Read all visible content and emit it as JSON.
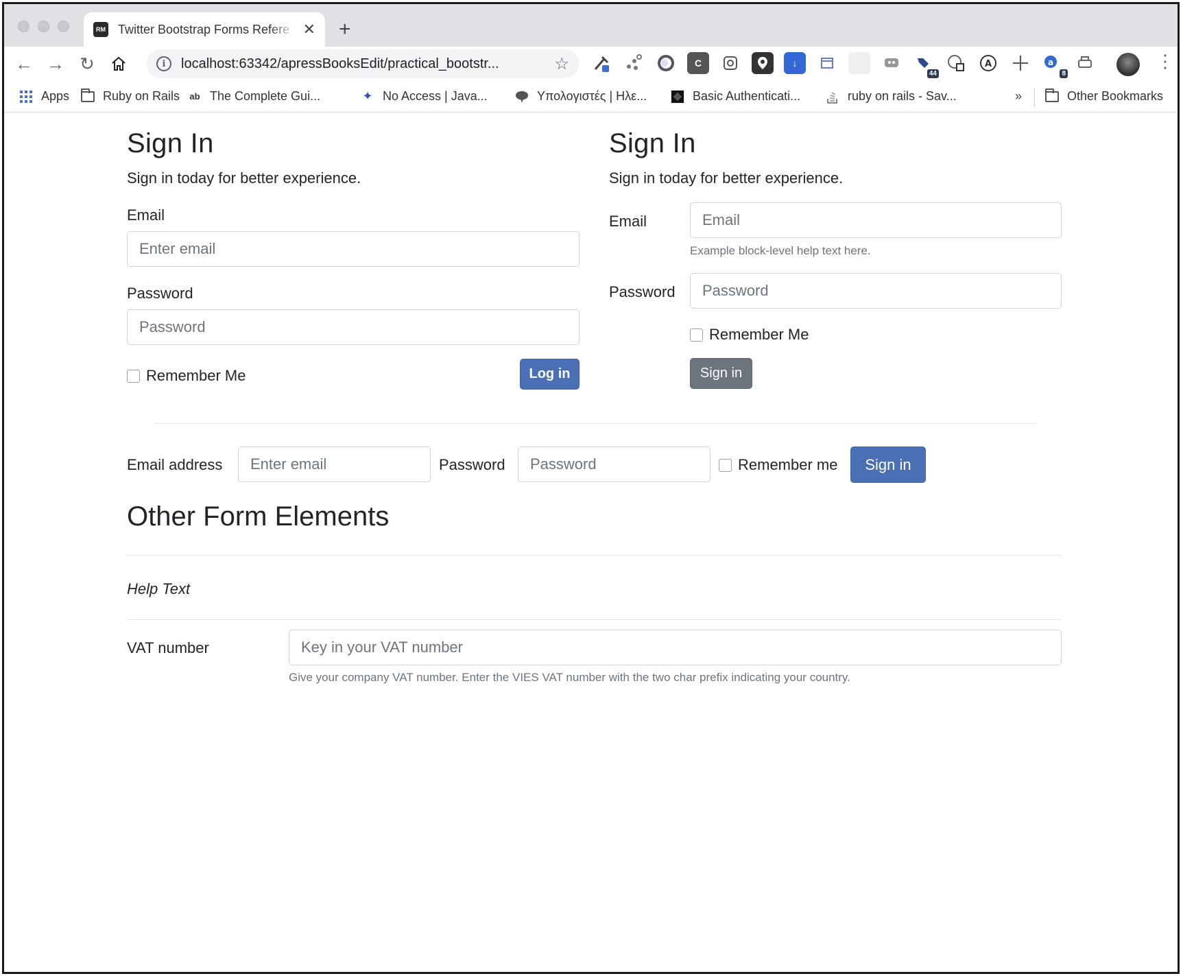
{
  "browser": {
    "tab_title": "Twitter Bootstrap Forms Refere",
    "tab_favicon_text": "RM",
    "url": "localhost:63342/apressBooksEdit/practical_bootstr...",
    "extension_badges": [
      "44",
      "8"
    ],
    "bookmarks": [
      {
        "label": "Apps",
        "icon": "apps-grid-icon"
      },
      {
        "label": "Ruby on Rails",
        "icon": "folder-icon"
      },
      {
        "label": "The Complete Gui...",
        "icon": "ab-icon"
      },
      {
        "label": "No Access | Java...",
        "icon": "sparkle-icon"
      },
      {
        "label": "Υπολογιστές | Ηλε...",
        "icon": "cloud-icon"
      },
      {
        "label": "Basic Authenticati...",
        "icon": "black-diamond-icon"
      },
      {
        "label": "ruby on rails - Sav...",
        "icon": "stackoverflow-icon"
      }
    ],
    "overflow_chevron": "»",
    "other_bookmarks": "Other Bookmarks"
  },
  "form_left": {
    "title": "Sign In",
    "lead": "Sign in today for better experience.",
    "email_label": "Email",
    "email_placeholder": "Enter email",
    "password_label": "Password",
    "password_placeholder": "Password",
    "remember_label": "Remember Me",
    "submit_label": "Log in"
  },
  "form_right": {
    "title": "Sign In",
    "lead": "Sign in today for better experience.",
    "email_label": "Email",
    "email_placeholder": "Email",
    "email_help": "Example block-level help text here.",
    "password_label": "Password",
    "password_placeholder": "Password",
    "remember_label": "Remember Me",
    "submit_label": "Sign in"
  },
  "form_inline": {
    "email_label": "Email address",
    "email_placeholder": "Enter email",
    "password_label": "Password",
    "password_placeholder": "Password",
    "remember_label": "Remember me",
    "submit_label": "Sign in"
  },
  "other": {
    "title": "Other Form Elements",
    "help_text_heading": "Help Text",
    "vat_label": "VAT number",
    "vat_placeholder": "Key in your VAT number",
    "vat_help": "Give your company VAT number. Enter the VIES VAT number with the two char prefix indicating your country."
  },
  "colors": {
    "primary": "#4a6fb5",
    "secondary": "#6c757d",
    "text": "#212529",
    "muted": "#6c757d"
  }
}
